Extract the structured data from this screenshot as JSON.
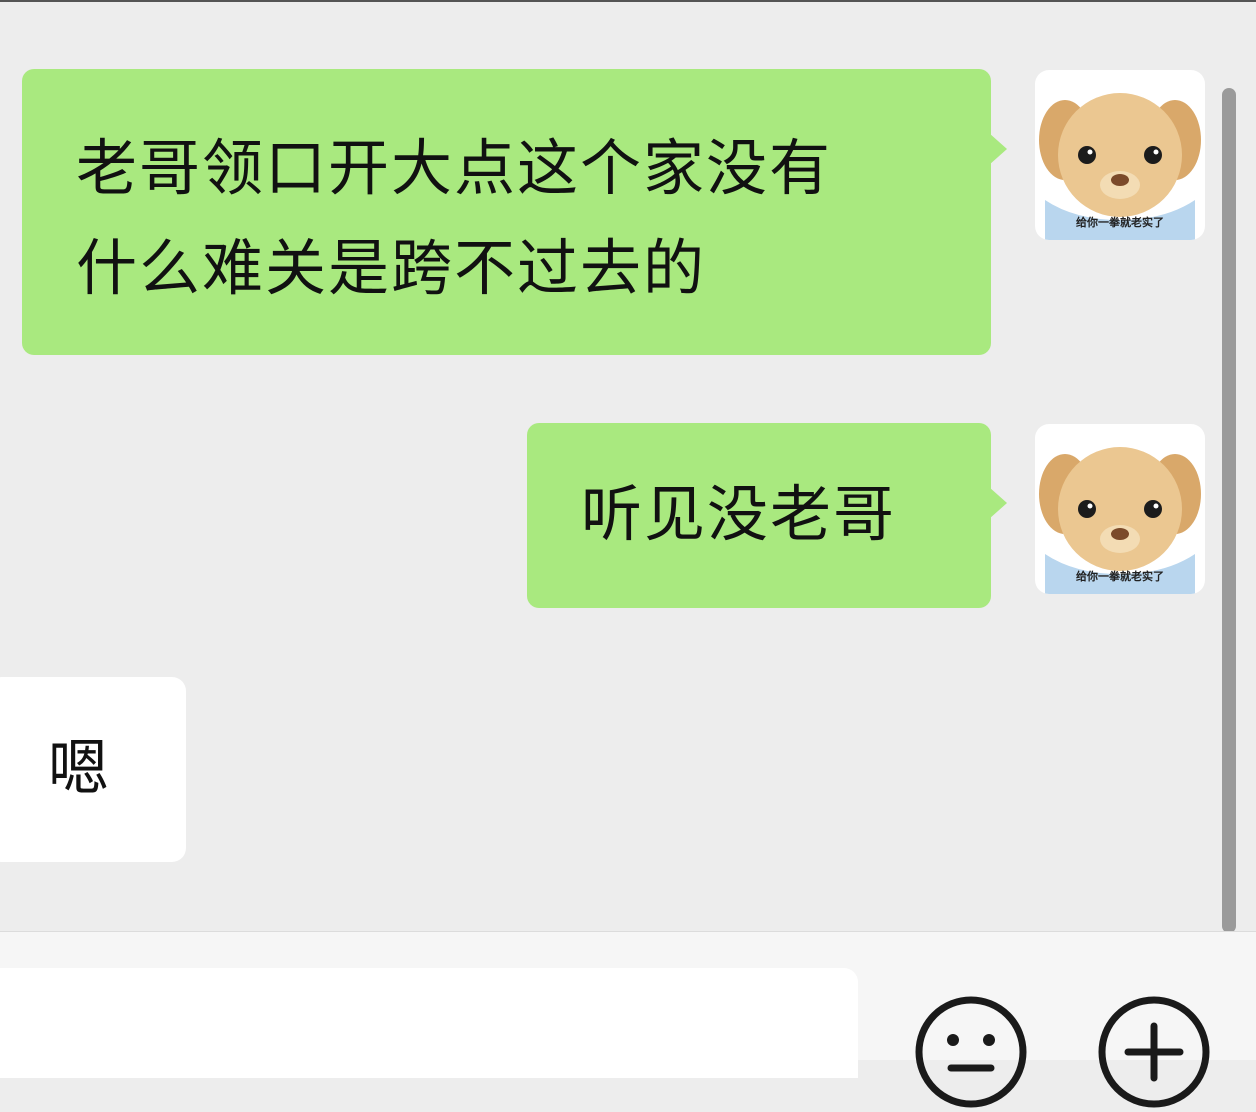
{
  "chat": {
    "messages": [
      {
        "sender": "me",
        "text": "老哥领口开大点这个家没有\n什么难关是跨不过去的"
      },
      {
        "sender": "me",
        "text": "听见没老哥"
      },
      {
        "sender": "them",
        "text": "嗯"
      }
    ]
  },
  "avatar": {
    "caption": "给你一拳就老实了",
    "icon": "teddy-bear-avatar"
  },
  "input_bar": {
    "value": "",
    "emoji_icon": "emoji-icon",
    "add_icon": "plus-icon"
  },
  "colors": {
    "chat_background": "#ededed",
    "my_bubble": "#a9e97f",
    "their_bubble": "#ffffff",
    "input_background": "#f6f6f6"
  }
}
